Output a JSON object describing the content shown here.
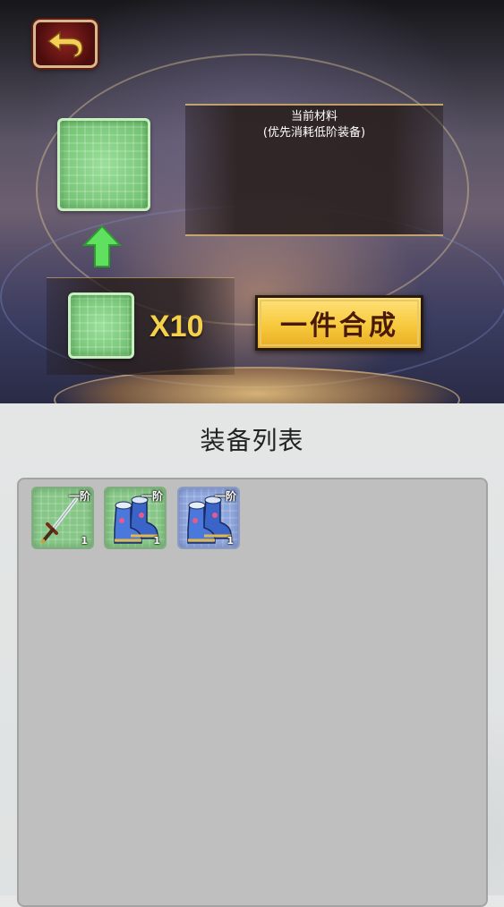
{
  "header": {
    "back_icon": "back-arrow-icon"
  },
  "synthesis": {
    "target_slot_icon": "empty-slot-icon",
    "arrow_icon": "up-arrow-icon",
    "material_title": "当前材料",
    "material_note": "(优先消耗低阶装备)",
    "material_slot_icon": "empty-slot-icon",
    "multiplier": "X10",
    "craft_button_label": "一件合成"
  },
  "equipment_list": {
    "title": "装备列表",
    "items": [
      {
        "icon": "sword-icon",
        "tier": "一阶",
        "count": "1",
        "rarity_color": "#86c686"
      },
      {
        "icon": "boots-icon",
        "tier": "一阶",
        "count": "1",
        "rarity_color": "#86c686"
      },
      {
        "icon": "boots-icon",
        "tier": "一阶",
        "count": "1",
        "rarity_color": "#8ea6dc"
      }
    ]
  },
  "colors": {
    "craft_button": "#f7c93e",
    "multiplier_text": "#f5d04a",
    "arrow": "#5fe05f",
    "common_rarity": "#86c686",
    "rare_rarity": "#8ea6dc"
  }
}
